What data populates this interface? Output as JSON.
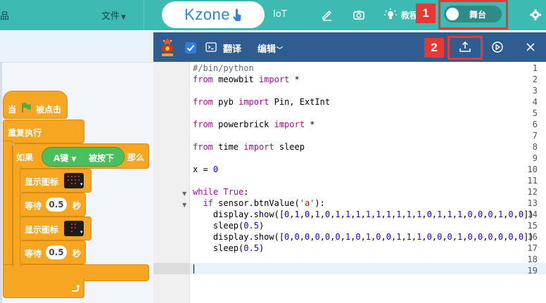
{
  "topbar": {
    "menu_tail": "品",
    "file_menu": "文件",
    "logo_text": "Kzone",
    "iot": "IoT",
    "tutorial": "教程",
    "stage_toggle_label": "舞台",
    "marker1": "1",
    "marker2": "2"
  },
  "blocks": {
    "when_flag": "当",
    "when_flag_suffix": "被点击",
    "repeat": "重复执行",
    "if": "如果",
    "key_dropdown": "A键",
    "key_pressed": "被按下",
    "then": "那么",
    "show_icon_1": "显示图标",
    "wait_1": "等待",
    "wait_value_1": "0.5",
    "seconds_1": "秒",
    "show_icon_2": "显示图标",
    "wait_2": "等待",
    "wait_value_2": "0.5",
    "seconds_2": "秒"
  },
  "editor": {
    "translate": "翻译",
    "edit_menu": "编辑",
    "line_numbers": [
      "1",
      "2",
      "3",
      "4",
      "5",
      "6",
      "7",
      "8",
      "9",
      "10",
      "11",
      "12",
      "13",
      "14",
      "15",
      "16",
      "17",
      "18",
      "19"
    ],
    "active_line": 19,
    "code_lines": [
      "#/bin/python",
      "from meowbit import *",
      "",
      "from pyb import Pin, ExtInt",
      "",
      "from powerbrick import *",
      "",
      "from time import sleep",
      "",
      "x = 0",
      "",
      "while True:",
      "  if sensor.btnValue('a'):",
      "    display.show([0,1,0,1,0,1,1,1,1,1,1,1,1,1,0,1,1,1,0,0,0,1,0,0])",
      "    sleep(0.5)",
      "    display.show([0,0,0,0,0,0,1,0,1,0,0,1,1,1,0,0,0,1,0,0,0,0,0,0])",
      "    sleep(0.5)",
      "",
      ""
    ]
  },
  "colors": {
    "topbar": "#3dbbb2",
    "editor_header": "#2f5d92",
    "block_orange": "#f7a621",
    "block_green": "#4cbf5d",
    "marker_red": "#e53935"
  },
  "icons": [
    "edit-icon",
    "camera-icon",
    "bulb-icon",
    "gear-icon",
    "upload-icon",
    "run-icon",
    "close-icon",
    "terminal-icon",
    "flag-icon",
    "hand-icon"
  ]
}
